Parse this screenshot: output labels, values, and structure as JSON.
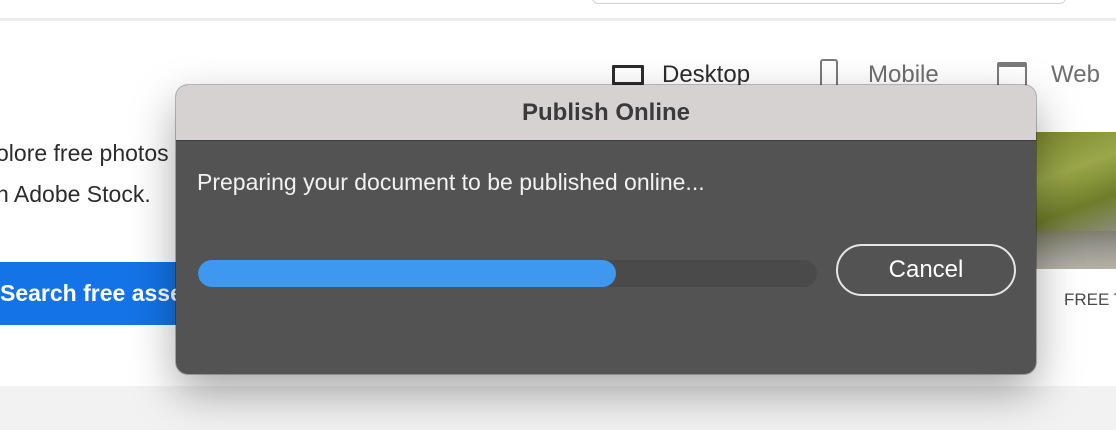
{
  "background": {
    "device_tabs": [
      {
        "label": "Desktop",
        "icon": "desktop-icon",
        "active": true
      },
      {
        "label": "Mobile",
        "icon": "mobile-icon",
        "active": false
      },
      {
        "label": "Web",
        "icon": "web-icon",
        "active": false
      }
    ],
    "hero_line1": "olore free photos",
    "hero_line2": "h Adobe Stock.",
    "search_button_label": "Search free assets",
    "thumbnail_label": "FREE T"
  },
  "dialog": {
    "title": "Publish Online",
    "message": "Preparing your document to be published online...",
    "progress_fraction": 0.675,
    "cancel_label": "Cancel",
    "colors": {
      "title_bar": "#d6d2d2",
      "body": "#535353",
      "progress_fill": "#3d98ee",
      "progress_track": "#4a4a4a"
    }
  }
}
